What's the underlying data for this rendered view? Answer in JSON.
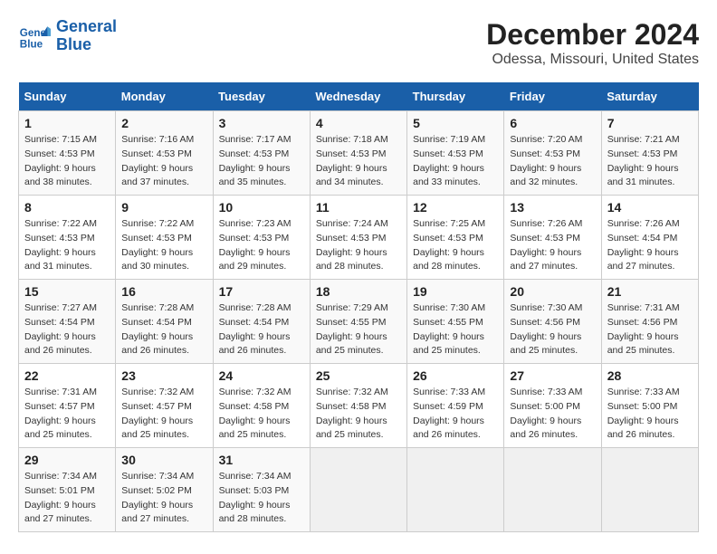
{
  "header": {
    "logo_line1": "General",
    "logo_line2": "Blue",
    "title": "December 2024",
    "subtitle": "Odessa, Missouri, United States"
  },
  "calendar": {
    "days_of_week": [
      "Sunday",
      "Monday",
      "Tuesday",
      "Wednesday",
      "Thursday",
      "Friday",
      "Saturday"
    ],
    "weeks": [
      [
        {
          "day": "1",
          "sunrise": "7:15 AM",
          "sunset": "4:53 PM",
          "daylight": "9 hours and 38 minutes."
        },
        {
          "day": "2",
          "sunrise": "7:16 AM",
          "sunset": "4:53 PM",
          "daylight": "9 hours and 37 minutes."
        },
        {
          "day": "3",
          "sunrise": "7:17 AM",
          "sunset": "4:53 PM",
          "daylight": "9 hours and 35 minutes."
        },
        {
          "day": "4",
          "sunrise": "7:18 AM",
          "sunset": "4:53 PM",
          "daylight": "9 hours and 34 minutes."
        },
        {
          "day": "5",
          "sunrise": "7:19 AM",
          "sunset": "4:53 PM",
          "daylight": "9 hours and 33 minutes."
        },
        {
          "day": "6",
          "sunrise": "7:20 AM",
          "sunset": "4:53 PM",
          "daylight": "9 hours and 32 minutes."
        },
        {
          "day": "7",
          "sunrise": "7:21 AM",
          "sunset": "4:53 PM",
          "daylight": "9 hours and 31 minutes."
        }
      ],
      [
        {
          "day": "8",
          "sunrise": "7:22 AM",
          "sunset": "4:53 PM",
          "daylight": "9 hours and 31 minutes."
        },
        {
          "day": "9",
          "sunrise": "7:22 AM",
          "sunset": "4:53 PM",
          "daylight": "9 hours and 30 minutes."
        },
        {
          "day": "10",
          "sunrise": "7:23 AM",
          "sunset": "4:53 PM",
          "daylight": "9 hours and 29 minutes."
        },
        {
          "day": "11",
          "sunrise": "7:24 AM",
          "sunset": "4:53 PM",
          "daylight": "9 hours and 28 minutes."
        },
        {
          "day": "12",
          "sunrise": "7:25 AM",
          "sunset": "4:53 PM",
          "daylight": "9 hours and 28 minutes."
        },
        {
          "day": "13",
          "sunrise": "7:26 AM",
          "sunset": "4:53 PM",
          "daylight": "9 hours and 27 minutes."
        },
        {
          "day": "14",
          "sunrise": "7:26 AM",
          "sunset": "4:54 PM",
          "daylight": "9 hours and 27 minutes."
        }
      ],
      [
        {
          "day": "15",
          "sunrise": "7:27 AM",
          "sunset": "4:54 PM",
          "daylight": "9 hours and 26 minutes."
        },
        {
          "day": "16",
          "sunrise": "7:28 AM",
          "sunset": "4:54 PM",
          "daylight": "9 hours and 26 minutes."
        },
        {
          "day": "17",
          "sunrise": "7:28 AM",
          "sunset": "4:54 PM",
          "daylight": "9 hours and 26 minutes."
        },
        {
          "day": "18",
          "sunrise": "7:29 AM",
          "sunset": "4:55 PM",
          "daylight": "9 hours and 25 minutes."
        },
        {
          "day": "19",
          "sunrise": "7:30 AM",
          "sunset": "4:55 PM",
          "daylight": "9 hours and 25 minutes."
        },
        {
          "day": "20",
          "sunrise": "7:30 AM",
          "sunset": "4:56 PM",
          "daylight": "9 hours and 25 minutes."
        },
        {
          "day": "21",
          "sunrise": "7:31 AM",
          "sunset": "4:56 PM",
          "daylight": "9 hours and 25 minutes."
        }
      ],
      [
        {
          "day": "22",
          "sunrise": "7:31 AM",
          "sunset": "4:57 PM",
          "daylight": "9 hours and 25 minutes."
        },
        {
          "day": "23",
          "sunrise": "7:32 AM",
          "sunset": "4:57 PM",
          "daylight": "9 hours and 25 minutes."
        },
        {
          "day": "24",
          "sunrise": "7:32 AM",
          "sunset": "4:58 PM",
          "daylight": "9 hours and 25 minutes."
        },
        {
          "day": "25",
          "sunrise": "7:32 AM",
          "sunset": "4:58 PM",
          "daylight": "9 hours and 25 minutes."
        },
        {
          "day": "26",
          "sunrise": "7:33 AM",
          "sunset": "4:59 PM",
          "daylight": "9 hours and 26 minutes."
        },
        {
          "day": "27",
          "sunrise": "7:33 AM",
          "sunset": "5:00 PM",
          "daylight": "9 hours and 26 minutes."
        },
        {
          "day": "28",
          "sunrise": "7:33 AM",
          "sunset": "5:00 PM",
          "daylight": "9 hours and 26 minutes."
        }
      ],
      [
        {
          "day": "29",
          "sunrise": "7:34 AM",
          "sunset": "5:01 PM",
          "daylight": "9 hours and 27 minutes."
        },
        {
          "day": "30",
          "sunrise": "7:34 AM",
          "sunset": "5:02 PM",
          "daylight": "9 hours and 27 minutes."
        },
        {
          "day": "31",
          "sunrise": "7:34 AM",
          "sunset": "5:03 PM",
          "daylight": "9 hours and 28 minutes."
        },
        null,
        null,
        null,
        null
      ]
    ]
  },
  "labels": {
    "sunrise_label": "Sunrise:",
    "sunset_label": "Sunset:",
    "daylight_label": "Daylight:"
  }
}
